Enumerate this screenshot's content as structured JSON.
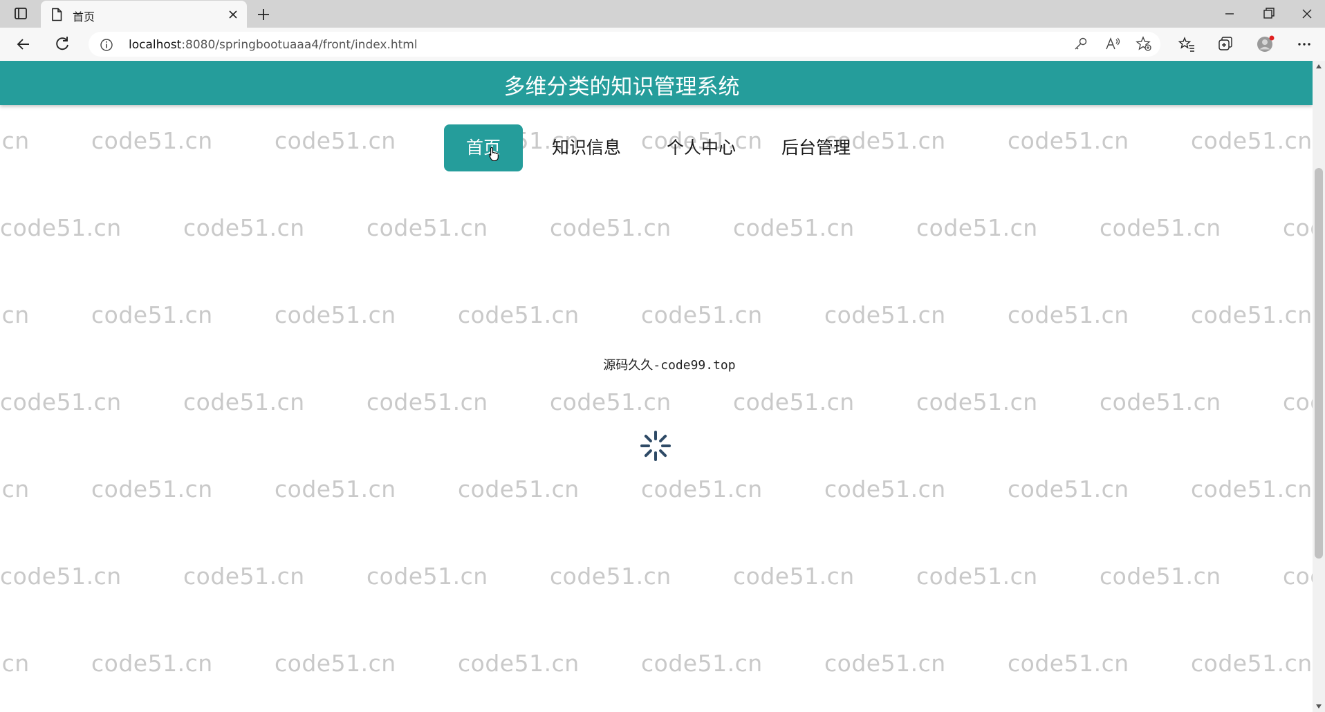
{
  "browser": {
    "tab": {
      "title": "首页",
      "favicon": "page-icon",
      "close_icon": "close-icon"
    },
    "new_tab_icon": "plus-icon",
    "window_controls": [
      "minimize-icon",
      "restore-icon",
      "close-icon"
    ],
    "address_bar": {
      "url_host": "localhost",
      "url_rest": ":8080/springbootuaaa4/front/index.html",
      "info_icon": "info-icon"
    },
    "toolbar_icons": [
      "key-icon",
      "read-aloud-icon",
      "add-favorite-icon",
      "favorites-icon",
      "collections-icon",
      "profile-icon",
      "more-icon"
    ],
    "profile_badge_color": "#e02020"
  },
  "page": {
    "header": {
      "title": "多维分类的知识管理系统",
      "bg_color": "#259d9b"
    },
    "nav": {
      "items": [
        {
          "label": "首页",
          "active": true
        },
        {
          "label": "知识信息",
          "active": false
        },
        {
          "label": "个人中心",
          "active": false
        },
        {
          "label": "后台管理",
          "active": false
        }
      ],
      "active_color": "#259d9b"
    },
    "footer_text": "源码久久-code99.top",
    "watermark_text": "code51.cn",
    "loading_icon": "spinner-icon"
  }
}
